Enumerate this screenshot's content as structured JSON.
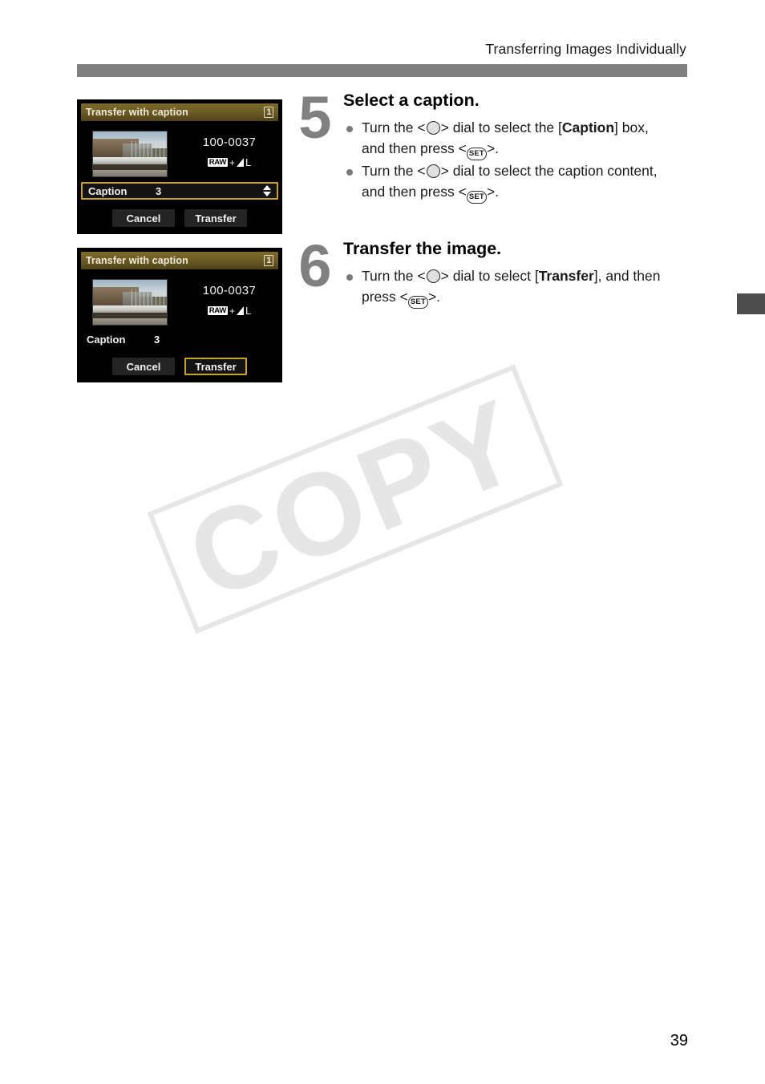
{
  "header": {
    "running_head": "Transferring Images Individually",
    "rule_color": "#808080"
  },
  "page": {
    "number": "39",
    "watermark": "COPY",
    "watermark_color": "#e6e6e6"
  },
  "steps": [
    {
      "number": "5",
      "title": "Select a caption.",
      "bullets": [
        {
          "part1": "Turn the <",
          "glyph1": "main-dial",
          "part2": "> dial to select the [",
          "bold": "Caption",
          "part3": "] box,",
          "line2_pre": "and then press <",
          "glyph2": "SET",
          "line2_post": ">."
        },
        {
          "part1": "Turn the <",
          "glyph1": "main-dial",
          "part2": "> dial to select the caption content,",
          "bold": "",
          "part3": "",
          "line2_pre": "and then press <",
          "glyph2": "SET",
          "line2_post": ">."
        }
      ]
    },
    {
      "number": "6",
      "title": "Transfer the image.",
      "bullets": [
        {
          "part1": "Turn the <",
          "glyph1": "main-dial",
          "part2": "> dial to select [",
          "bold": "Transfer",
          "part3": "], and then",
          "line2_pre": "press <",
          "glyph2": "SET",
          "line2_post": ">."
        }
      ]
    }
  ],
  "screens": [
    {
      "title": "Transfer with caption",
      "card_badge": "1",
      "file_number": "100-0037",
      "quality_raw": "RAW",
      "quality_plus": "+",
      "quality_jpeg": "L",
      "caption_label": "Caption",
      "caption_value": "3",
      "caption_selected": true,
      "stepper_visible": true,
      "buttons": [
        {
          "label": "Cancel",
          "selected": false
        },
        {
          "label": "Transfer",
          "selected": false
        }
      ],
      "highlight_color": "#c8a22a"
    },
    {
      "title": "Transfer with caption",
      "card_badge": "1",
      "file_number": "100-0037",
      "quality_raw": "RAW",
      "quality_plus": "+",
      "quality_jpeg": "L",
      "caption_label": "Caption",
      "caption_value": "3",
      "caption_selected": false,
      "stepper_visible": false,
      "buttons": [
        {
          "label": "Cancel",
          "selected": false
        },
        {
          "label": "Transfer",
          "selected": true
        }
      ],
      "highlight_color": "#c8a22a"
    }
  ]
}
